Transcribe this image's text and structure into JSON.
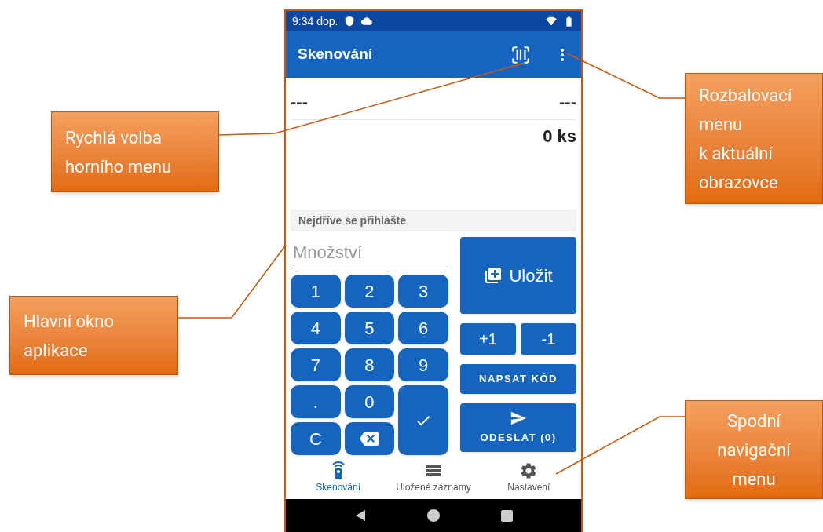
{
  "status_bar": {
    "time": "9:34 dop."
  },
  "app_bar": {
    "title": "Skenování"
  },
  "summary": {
    "left": "---",
    "right": "---",
    "count": "0 ks"
  },
  "notice": "Nejdříve se přihlašte",
  "quantity_field": {
    "placeholder": "Množství"
  },
  "keypad": [
    {
      "kind": "text",
      "label": "1"
    },
    {
      "kind": "text",
      "label": "2"
    },
    {
      "kind": "text",
      "label": "3"
    },
    {
      "kind": "text",
      "label": "4"
    },
    {
      "kind": "text",
      "label": "5"
    },
    {
      "kind": "text",
      "label": "6"
    },
    {
      "kind": "text",
      "label": "7"
    },
    {
      "kind": "text",
      "label": "8"
    },
    {
      "kind": "text",
      "label": "9"
    },
    {
      "kind": "text",
      "label": "."
    },
    {
      "kind": "text",
      "label": "0"
    },
    {
      "kind": "confirm"
    },
    {
      "kind": "text",
      "label": "C"
    },
    {
      "kind": "backspace"
    }
  ],
  "actions": {
    "save": "Uložit",
    "plus": "+1",
    "minus": "-1",
    "write_code": "NAPSAT KÓD",
    "send": "ODESLAT (0)"
  },
  "bottom_nav": [
    {
      "label": "Skenování",
      "selected": true
    },
    {
      "label": "Uložené záznamy",
      "selected": false
    },
    {
      "label": "Nastavení",
      "selected": false
    }
  ],
  "callouts": [
    {
      "lines": [
        "Rychlá volba",
        "horního menu"
      ],
      "kind": "plain"
    },
    {
      "lines": [
        "Rozbalovací",
        "menu",
        "k aktuální",
        "obrazovce"
      ],
      "kind": "plain"
    },
    {
      "lines": [
        "Hlavní okno",
        "aplikace"
      ],
      "kind": "plain"
    },
    {
      "lines": [
        "Spodní",
        "navigační",
        "menu"
      ],
      "kind": "centered"
    }
  ]
}
